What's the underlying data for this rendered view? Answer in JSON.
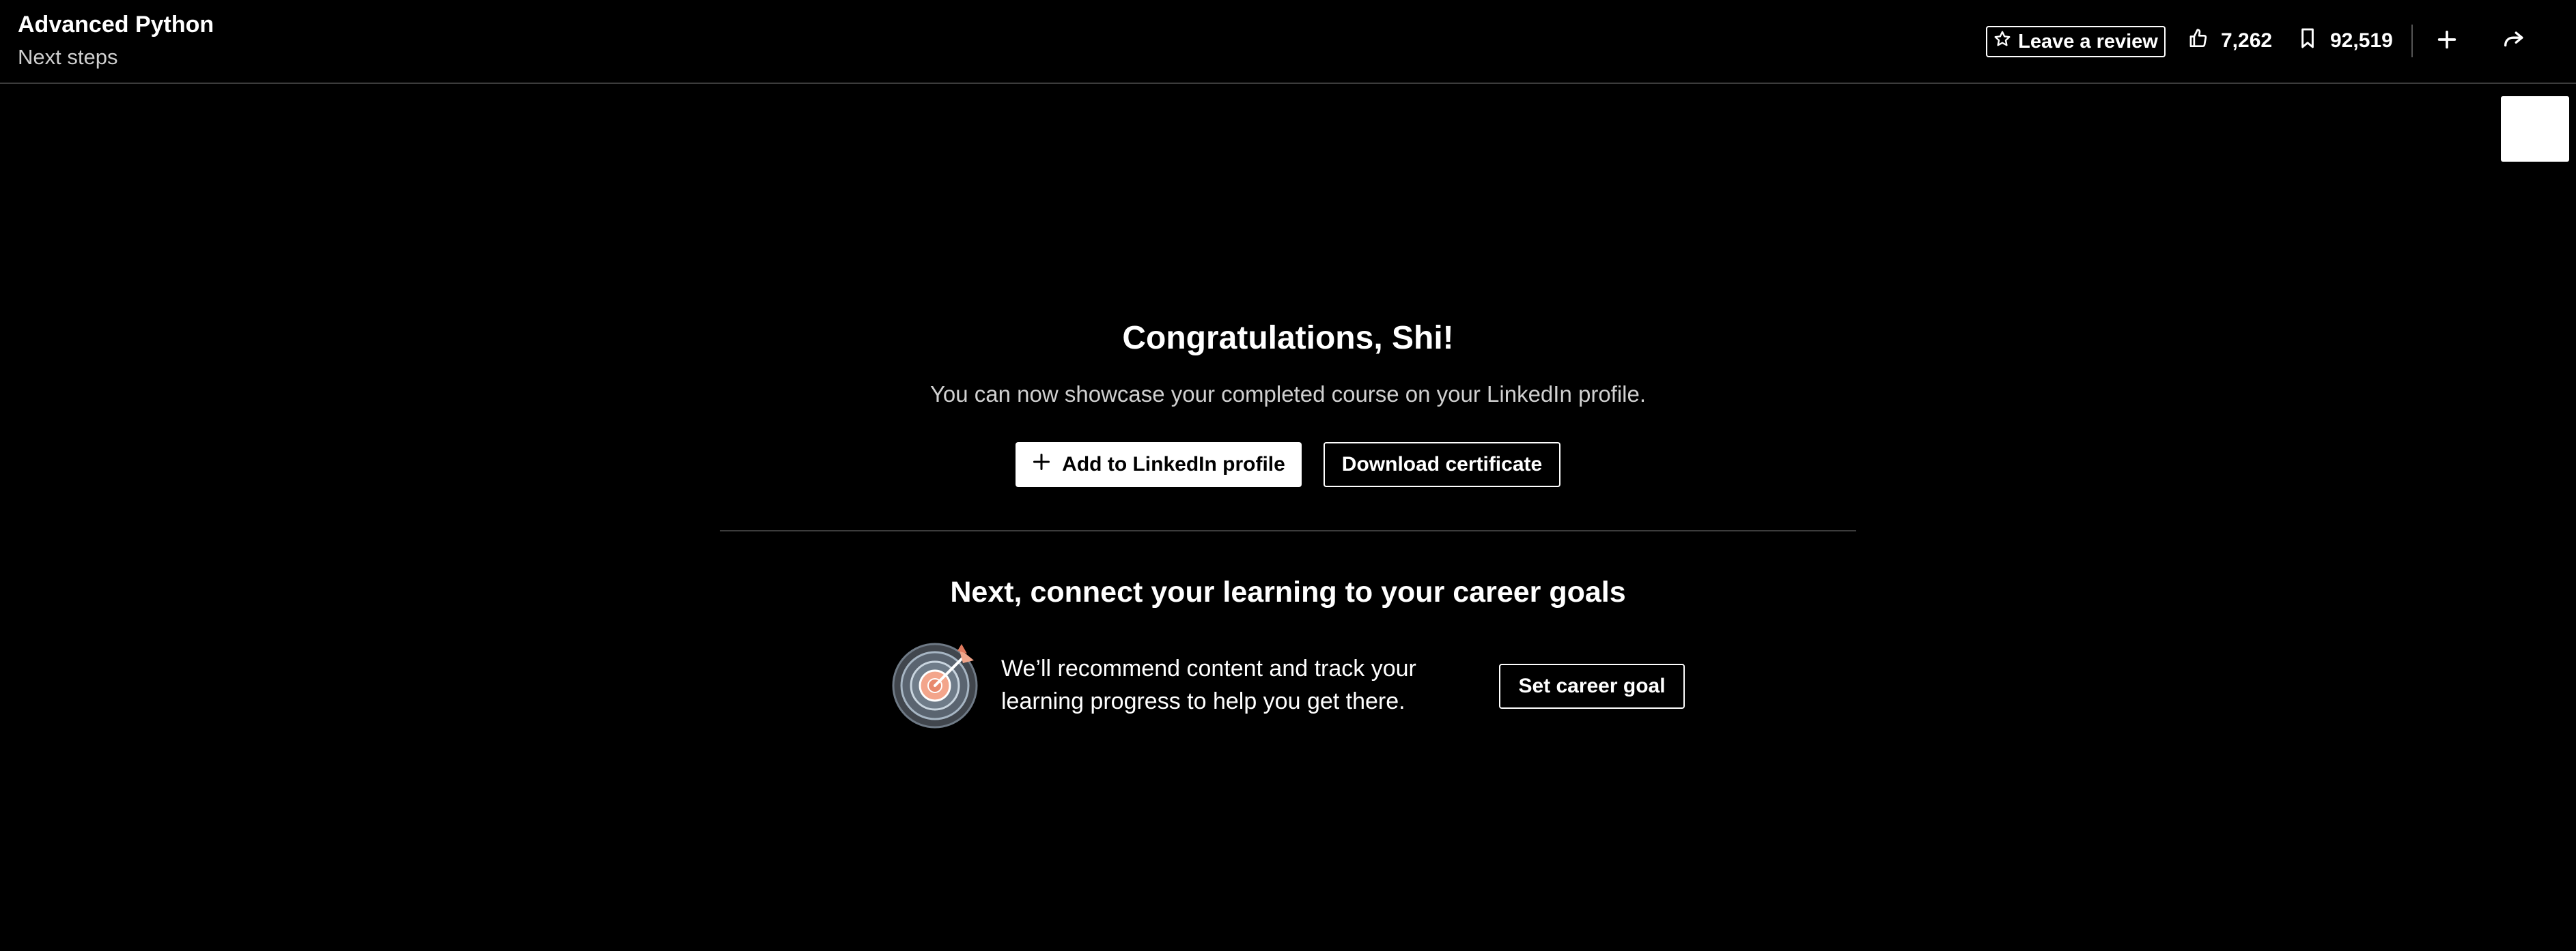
{
  "header": {
    "course_title": "Advanced Python",
    "section_title": "Next steps",
    "review_label": "Leave a review",
    "likes_count": "7,262",
    "saves_count": "92,519",
    "icons": {
      "review": "star-icon",
      "likes": "thumbs-up-icon",
      "saves": "bookmark-icon",
      "add": "plus-icon",
      "share": "share-arrow-icon"
    }
  },
  "completion": {
    "heading": "Congratulations, Shi!",
    "message": "You can now showcase your completed course on your LinkedIn profile.",
    "add_profile_label": "Add to LinkedIn profile",
    "download_label": "Download certificate"
  },
  "career": {
    "heading": "Next, connect your learning to your career goals",
    "description": "We’ll recommend content and track your learning progress to help you get there.",
    "button_label": "Set career goal",
    "illustration": "target-illustration"
  },
  "colors": {
    "background": "#000000",
    "text": "#ffffff",
    "muted_text": "#cfcfcf",
    "divider": "#3c3c3c",
    "accent_target": "#f0a58a"
  }
}
